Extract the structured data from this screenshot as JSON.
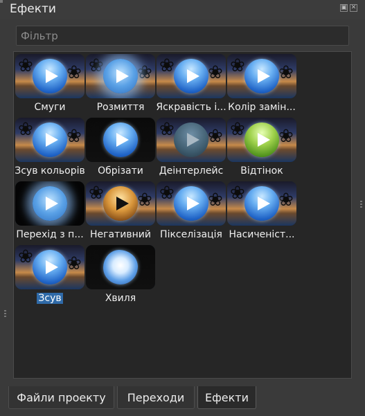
{
  "panel": {
    "title": "Ефекти"
  },
  "filter": {
    "placeholder": "Фільтр",
    "value": ""
  },
  "effects": [
    {
      "label": "Смуги",
      "orb": "blue",
      "bg": "sunset"
    },
    {
      "label": "Розмиття",
      "orb": "hazy",
      "bg": "sunset"
    },
    {
      "label": "Яскравість і...",
      "orb": "blue",
      "bg": "sunset"
    },
    {
      "label": "Колір замін...",
      "orb": "blue",
      "bg": "sunset"
    },
    {
      "label": "Зсув кольорів",
      "orb": "blue",
      "bg": "sunset"
    },
    {
      "label": "Обрізати",
      "orb": "blue",
      "bg": "dark"
    },
    {
      "label": "Деінтерлейс",
      "orb": "dim",
      "bg": "sunset"
    },
    {
      "label": "Відтінок",
      "orb": "green",
      "bg": "sunset"
    },
    {
      "label": "Перехід з п...",
      "orb": "hazy",
      "bg": "black"
    },
    {
      "label": "Негативний",
      "orb": "gold",
      "bg": "sunset"
    },
    {
      "label": "Пікселізація",
      "orb": "blue",
      "bg": "sunset"
    },
    {
      "label": "Насиченіст...",
      "orb": "blue",
      "bg": "sunset"
    },
    {
      "label": "Зсув",
      "orb": "blue",
      "bg": "sunset",
      "selected": true
    },
    {
      "label": "Хвиля",
      "orb": "wave",
      "bg": "dark"
    }
  ],
  "tabs": [
    {
      "label": "Файли проекту",
      "active": false
    },
    {
      "label": "Переходи",
      "active": false
    },
    {
      "label": "Ефекти",
      "active": true
    }
  ],
  "icons": {
    "float": "float-icon",
    "close": "close-icon",
    "play": "play-icon"
  },
  "colors": {
    "selection": "#2f6aa8",
    "panel": "#3a3a3a",
    "grid": "#262626"
  }
}
